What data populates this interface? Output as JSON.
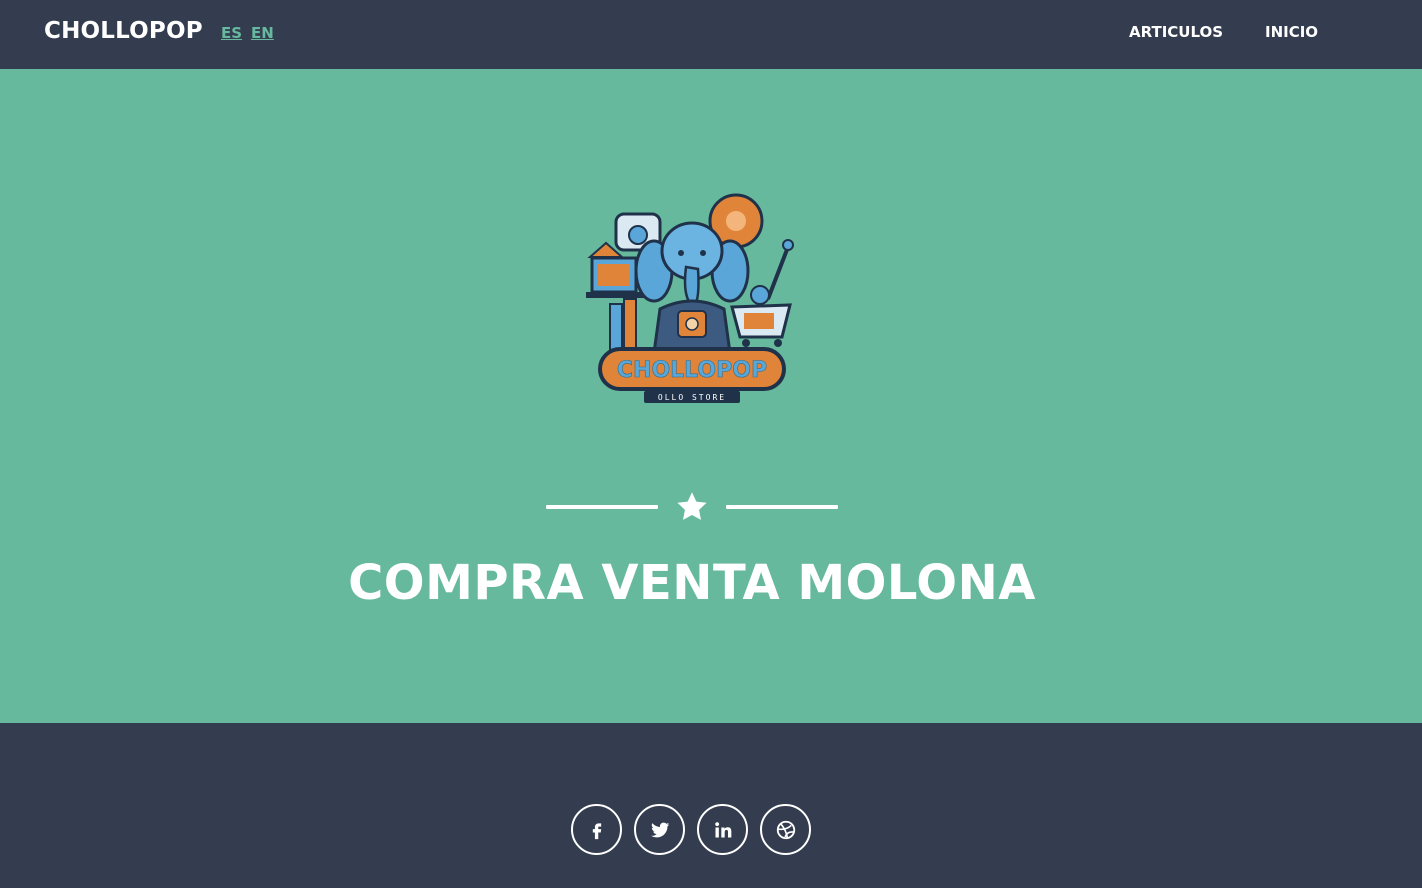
{
  "navbar": {
    "brand": "CHOLLOPOP",
    "languages": [
      "ES",
      "EN"
    ],
    "links": [
      "ARTICULOS",
      "INICIO"
    ]
  },
  "masthead": {
    "logo": {
      "text": "CHOLLOPOP",
      "subtext": "OLLO STORE"
    },
    "divider_icon": "star-icon",
    "headline": "COMPRA VENTA MOLONA"
  },
  "footer": {
    "social": [
      "facebook-icon",
      "twitter-icon",
      "linkedin-icon",
      "dribbble-icon"
    ]
  },
  "colors": {
    "primary": "#67b99e",
    "dark": "#343d4f",
    "white": "#ffffff",
    "logo_orange": "#e0843a",
    "logo_blue": "#5aa6d8"
  }
}
